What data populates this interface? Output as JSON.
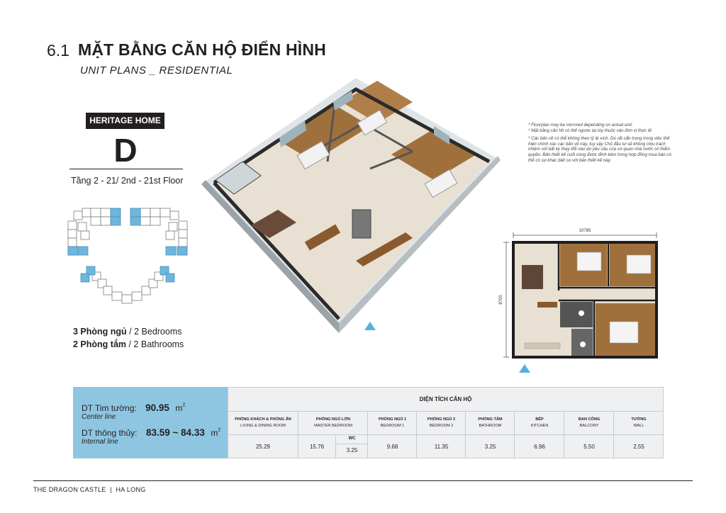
{
  "header": {
    "section_number": "6.1",
    "title": "MẶT BẰNG CĂN HỘ ĐIỂN HÌNH",
    "subtitle": "UNIT PLANS _ RESIDENTIAL"
  },
  "unit": {
    "badge": "HERITAGE HOME",
    "letter": "D",
    "floor": "Tầng 2 - 21/ 2nd - 21st Floor",
    "bedrooms_bold": "3 Phòng ngủ",
    "bedrooms_rest": " / 2 Bedrooms",
    "bathrooms_bold": "2 Phòng tắm",
    "bathrooms_rest": " / 2 Bathrooms"
  },
  "notes": {
    "line1": "* Floorplan may be mirrored depending on actual unit.",
    "line2": "* Mặt bằng căn hộ có thể ngược lại tùy thuộc vào đơn vị thực tế",
    "line3": "* Các bản vẽ có thể không theo tỷ lệ xích. Dù rất cẩn trọng trong việc thể hiện chính xác các bản vẽ này, tuy vậy Chủ đầu tư sẽ không chịu trách nhiệm với bất kỳ thay đổi nào do yêu cầu của cơ quan nhà nước có thẩm quyền. Bản thiết kế cuối cùng được đính kèm trong hợp đồng mua bán có thể có sự khác biệt so với bản thiết kế này."
  },
  "plan": {
    "width_dim": "10785",
    "height_dim": "8700"
  },
  "area": {
    "gross_label": "DT Tim tường:",
    "gross_value": "90.95",
    "gross_unit": "m",
    "gross_sub": "Center line",
    "net_label": "DT thông thủy:",
    "net_value": "83.59 ~ 84.33",
    "net_unit": "m",
    "net_sub": "Internal line",
    "unit_power": "2"
  },
  "table": {
    "title": "DIỆN TÍCH CĂN HỘ",
    "columns": [
      {
        "vn": "PHÒNG KHÁCH & PHÒNG ĂN",
        "en": "LIVING & DINING ROOM",
        "value": "25.29"
      },
      {
        "vn": "PHÒNG NGỦ LỚN",
        "en": "MASTER BEDROOM",
        "value": "15.76",
        "wc_label": "WC",
        "wc_value": "3.25"
      },
      {
        "vn": "PHÒNG NGỦ 1",
        "en": "BEDROOM 1",
        "value": "9.68"
      },
      {
        "vn": "PHÒNG NGỦ 2",
        "en": "BEDROOM 2",
        "value": "11.35"
      },
      {
        "vn": "PHÒNG TẮM",
        "en": "BATHROOM",
        "value": "3.25"
      },
      {
        "vn": "BẾP",
        "en": "KITCHEN",
        "value": "6.96"
      },
      {
        "vn": "BAN CÔNG",
        "en": "BALCONY",
        "value": "5.50"
      },
      {
        "vn": "TƯỜNG",
        "en": "WALL",
        "value": "2.55"
      }
    ]
  },
  "footer": {
    "text": "THE DRAGON CASTLE  |  HA LONG"
  },
  "colors": {
    "accent_blue": "#8ec6e1",
    "dark": "#231f20",
    "wood": "#a0703c",
    "floor_tile": "#e8e0d2"
  }
}
